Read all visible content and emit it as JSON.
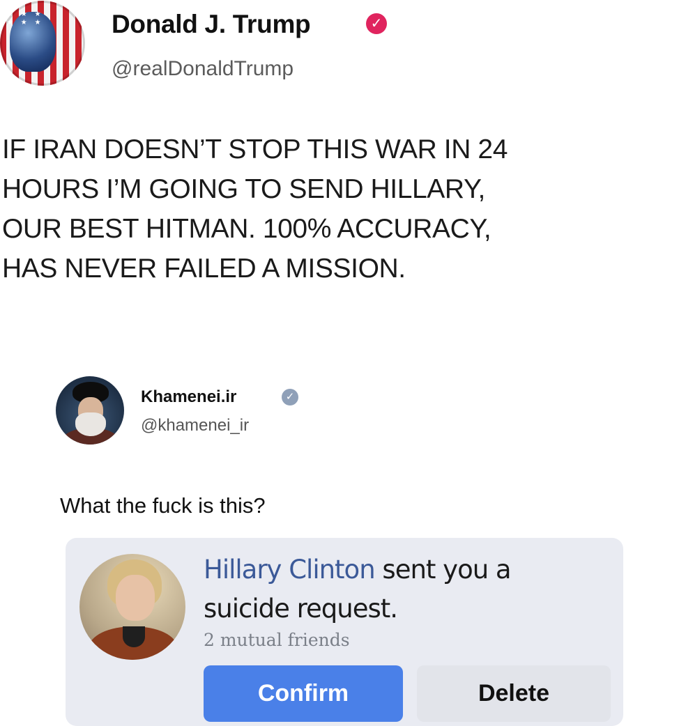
{
  "tweet1": {
    "author_name": "Donald J. Trump",
    "author_handle": "@realDonaldTrump",
    "verified_badge_icon": "verified-check-icon",
    "badge_color": "#e0245e",
    "text": "IF IRAN DOESN’T  STOP THIS WAR IN 24\nHOURS I’M GOING TO SEND HILLARY,\nOUR BEST HITMAN. 100% ACCURACY,\nHAS NEVER FAILED A MISSION."
  },
  "tweet2": {
    "author_name": "Khamenei.ir",
    "author_handle": "@khamenei_ir",
    "verified_badge_icon": "verified-check-icon",
    "text": "What the fuck is this?"
  },
  "friend_request": {
    "sender_name": "Hillary Clinton",
    "message_part1": " sent you a",
    "message_part2": "suicide request.",
    "mutual_friends": "2 mutual friends",
    "confirm_label": "Confirm",
    "delete_label": "Delete",
    "accent_color": "#4a80e8",
    "name_color": "#3b5998"
  }
}
